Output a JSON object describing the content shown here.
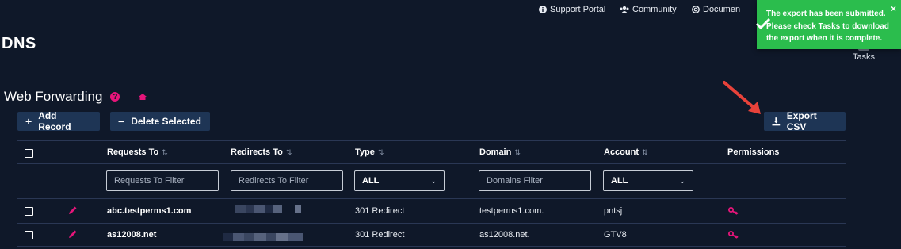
{
  "topnav": {
    "support_label": "Support Portal",
    "community_label": "Community",
    "docs_label": "Documen"
  },
  "page_title": "DNS",
  "tasks_label": "Tasks",
  "section_title": "Web Forwarding",
  "toolbar": {
    "add_label": "Add Record",
    "delete_label": "Delete Selected",
    "export_label": "Export CSV"
  },
  "toast": {
    "message": "The export has been submitted. Please check Tasks to download the export when it is complete.",
    "close_glyph": "×",
    "color": "#2bbd4d"
  },
  "table": {
    "headers": {
      "requests_to": "Requests To",
      "redirects_to": "Redirects To",
      "type": "Type",
      "domain": "Domain",
      "account": "Account",
      "permissions": "Permissions"
    },
    "sort_glyph": "⇅",
    "filters": {
      "requests_placeholder": "Requests To Filter",
      "redirects_placeholder": "Redirects To Filter",
      "type_value": "ALL",
      "domain_placeholder": "Domains Filter",
      "account_value": "ALL"
    },
    "rows": [
      {
        "requests_to": "abc.testperms1.com",
        "type": "301 Redirect",
        "domain": "testperms1.com.",
        "account": "pntsj"
      },
      {
        "requests_to": "as12008.net",
        "type": "301 Redirect",
        "domain": "as12008.net.",
        "account": "GTV8"
      }
    ]
  },
  "colors": {
    "background": "#0f1829",
    "button": "#1e3555",
    "accent_pink": "#e6157a",
    "annotation_arrow": "#e8423a"
  }
}
